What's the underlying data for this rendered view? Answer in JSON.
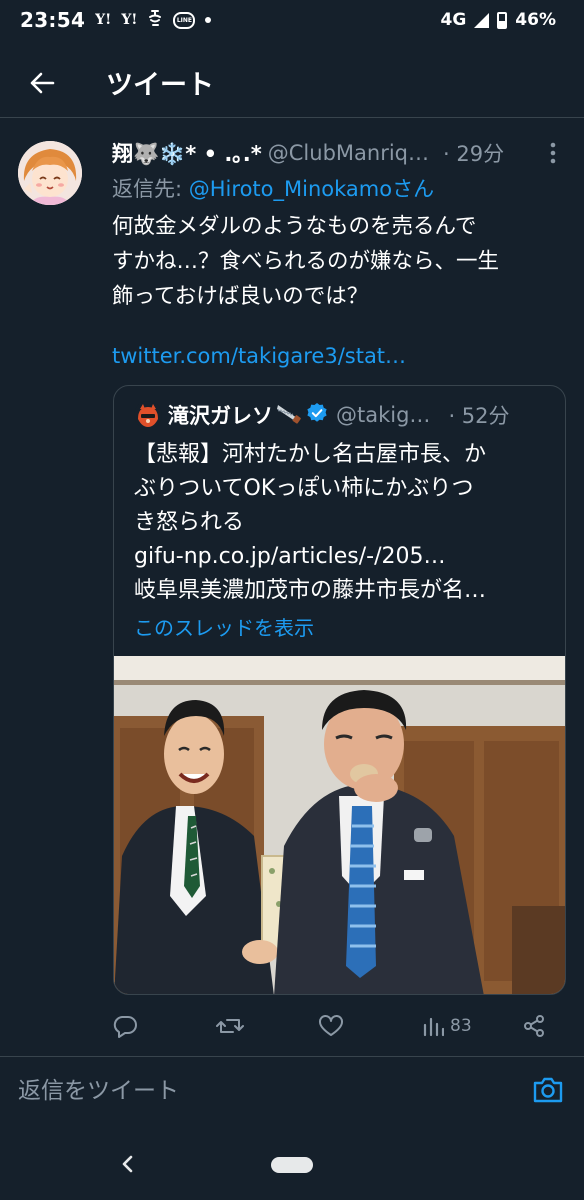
{
  "status_bar": {
    "time": "23:54",
    "icons": [
      "yahoo-icon",
      "yahoo-icon",
      "app-notification-icon",
      "line-icon",
      "dot-icon"
    ],
    "yahoo_label": "Y!",
    "line_label": "LINE",
    "network": "4G",
    "battery": "46%",
    "battery_level": 0.46
  },
  "header": {
    "title": "ツイート",
    "back_icon": "arrow-left-icon"
  },
  "tweet": {
    "display_name": "翔🐺❄️* • .｡.*",
    "handle": "@ClubManriq…",
    "time_ago": "· 29分",
    "reply_prefix": "返信先: ",
    "reply_mention": "@Hiroto_Minokamo",
    "reply_suffix": "さん",
    "text_lines": [
      "何故金メダルのようなものを売るんで",
      "すかね…？食べられるのが嫌なら、一生",
      "飾っておけば良いのでは？"
    ],
    "link": "twitter.com/takigare3/stat…"
  },
  "quote": {
    "display_name": "滝沢ガレソ",
    "handle": "@takig…",
    "time_ago": "· 52分",
    "lines": [
      "【悲報】河村たかし名古屋市長、か",
      "ぶりついてOKっぽい柿にかぶりつ",
      "き怒られる",
      "gifu-np.co.jp/articles/-/205…",
      "岐阜県美濃加茂市の藤井市長が名…"
    ],
    "show_thread": "このスレッドを表示"
  },
  "actions": {
    "reply_icon": "reply-icon",
    "retweet_icon": "retweet-icon",
    "like_icon": "heart-icon",
    "analytics_icon": "analytics-icon",
    "views_count": "83",
    "share_icon": "share-icon"
  },
  "reply_bar": {
    "placeholder": "返信をツイート",
    "camera_icon": "camera-icon"
  },
  "colors": {
    "background": "#15202b",
    "accent": "#1d9bf0",
    "secondary_text": "#8b98a5",
    "border": "#38444d"
  }
}
